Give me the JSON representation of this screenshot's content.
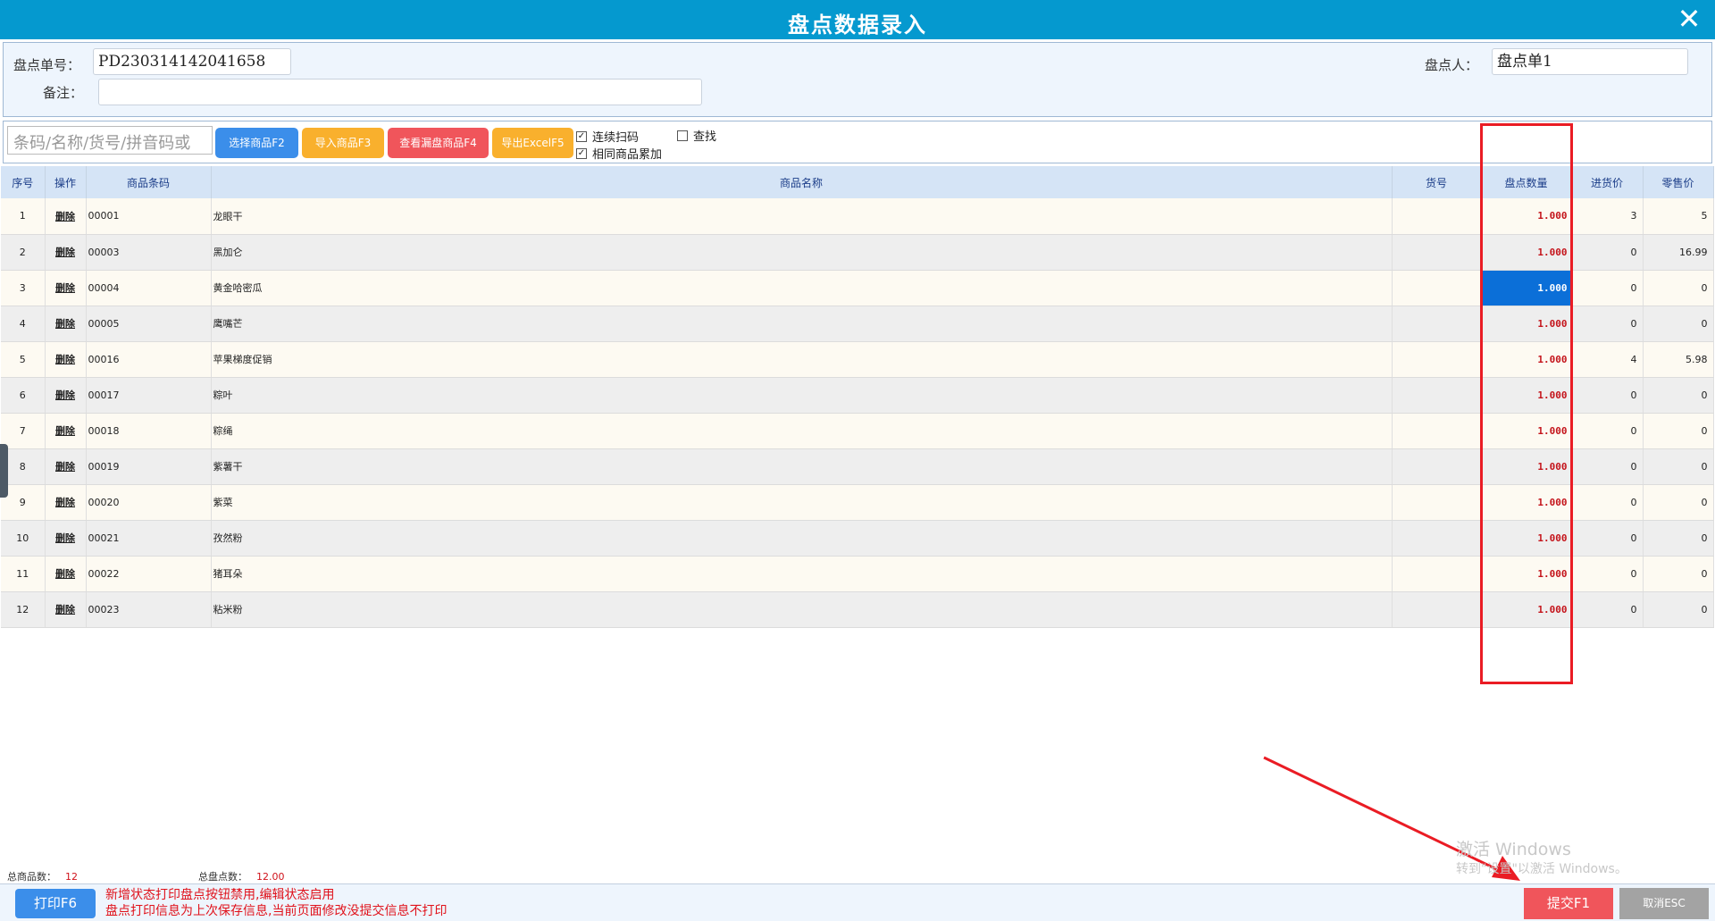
{
  "window": {
    "title": "盘点数据录入",
    "close_glyph": "✕"
  },
  "form": {
    "order_no_label": "盘点单号：",
    "order_no_value": "PD230314142041658",
    "counter_label": "盘点人：",
    "counter_value": "盘点单1",
    "remark_label": "备注：",
    "remark_value": ""
  },
  "toolbar": {
    "search_placeholder": "条码/名称/货号/拼音码或",
    "buttons": [
      {
        "label": "选择商品F2",
        "color": "#3b8eea"
      },
      {
        "label": "导入商品F3",
        "color": "#f9b02d"
      },
      {
        "label": "查看漏盘商品F4",
        "color": "#f0555b"
      },
      {
        "label": "导出ExcelF5",
        "color": "#f9b02d"
      }
    ],
    "checkboxes": [
      {
        "label": "连续扫码",
        "checked": true
      },
      {
        "label": "相同商品累加",
        "checked": true
      },
      {
        "label": "查找",
        "checked": false
      }
    ]
  },
  "table": {
    "headers": [
      "序号",
      "操作",
      "商品条码",
      "商品名称",
      "货号",
      "盘点数量",
      "进货价",
      "零售价"
    ],
    "delete_label": "删除",
    "selected_row": 3,
    "rows": [
      {
        "idx": "1",
        "code": "00001",
        "name": "龙眼干",
        "sku": "",
        "qty": "1.000",
        "cost": "3",
        "price": "5"
      },
      {
        "idx": "2",
        "code": "00003",
        "name": "黑加仑",
        "sku": "",
        "qty": "1.000",
        "cost": "0",
        "price": "16.99"
      },
      {
        "idx": "3",
        "code": "00004",
        "name": "黄金哈密瓜",
        "sku": "",
        "qty": "1.000",
        "cost": "0",
        "price": "0"
      },
      {
        "idx": "4",
        "code": "00005",
        "name": "鹰嘴芒",
        "sku": "",
        "qty": "1.000",
        "cost": "0",
        "price": "0"
      },
      {
        "idx": "5",
        "code": "00016",
        "name": "苹果梯度促销",
        "sku": "",
        "qty": "1.000",
        "cost": "4",
        "price": "5.98"
      },
      {
        "idx": "6",
        "code": "00017",
        "name": "粽叶",
        "sku": "",
        "qty": "1.000",
        "cost": "0",
        "price": "0"
      },
      {
        "idx": "7",
        "code": "00018",
        "name": "粽绳",
        "sku": "",
        "qty": "1.000",
        "cost": "0",
        "price": "0"
      },
      {
        "idx": "8",
        "code": "00019",
        "name": "紫薯干",
        "sku": "",
        "qty": "1.000",
        "cost": "0",
        "price": "0"
      },
      {
        "idx": "9",
        "code": "00020",
        "name": "紫菜",
        "sku": "",
        "qty": "1.000",
        "cost": "0",
        "price": "0"
      },
      {
        "idx": "10",
        "code": "00021",
        "name": "孜然粉",
        "sku": "",
        "qty": "1.000",
        "cost": "0",
        "price": "0"
      },
      {
        "idx": "11",
        "code": "00022",
        "name": "猪耳朵",
        "sku": "",
        "qty": "1.000",
        "cost": "0",
        "price": "0"
      },
      {
        "idx": "12",
        "code": "00023",
        "name": "粘米粉",
        "sku": "",
        "qty": "1.000",
        "cost": "0",
        "price": "0"
      }
    ]
  },
  "summary": {
    "total_items_label": "总商品数：",
    "total_items_value": "12",
    "total_count_label": "总盘点数：",
    "total_count_value": "12.00"
  },
  "footer": {
    "print_label": "打印F6",
    "note_line1": "新增状态打印盘点按钮禁用,编辑状态启用",
    "note_line2": "盘点打印信息为上次保存信息,当前页面修改没提交信息不打印",
    "submit_label": "提交F1",
    "cancel_label": "取消ESC"
  },
  "watermark": {
    "line1": "激活 Windows",
    "line2": "转到\"设置\"以激活 Windows。"
  },
  "colors": {
    "titlebar": "#0599cf",
    "highlight": "#ea1c24",
    "qty_text": "#c4141b",
    "selected_cell": "#0b6fd8"
  }
}
